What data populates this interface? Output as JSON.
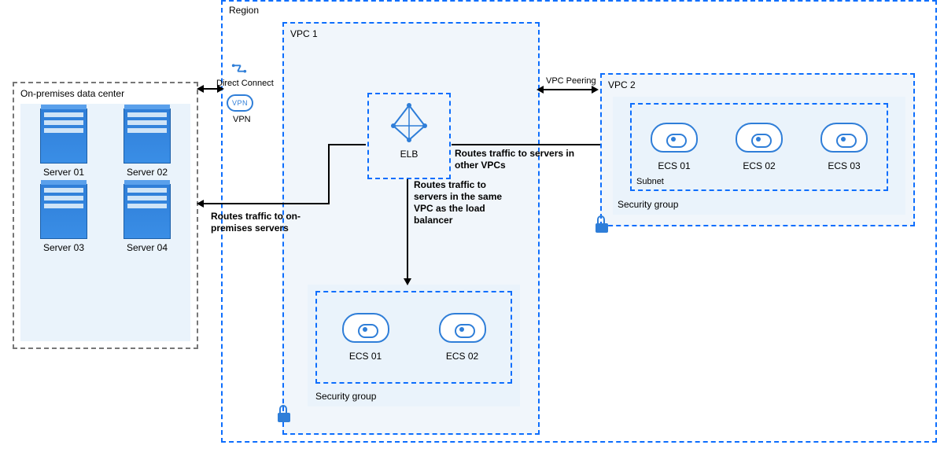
{
  "region_label": "Region",
  "onprem": {
    "title": "On-premises data center",
    "servers": [
      "Server 01",
      "Server 02",
      "Server 03",
      "Server 04"
    ]
  },
  "connections": {
    "direct_connect": "Direct Connect",
    "vpn": "VPN",
    "vpc_peering": "VPC Peering"
  },
  "routes": {
    "to_onprem": "Routes traffic to on-premises servers",
    "same_vpc": "Routes traffic to servers in the same VPC as the load balancer",
    "other_vpcs": "Routes traffic to servers in other VPCs"
  },
  "vpc1": {
    "label": "VPC 1",
    "elb_label": "ELB",
    "security_group_label": "Security group",
    "ecs": [
      "ECS 01",
      "ECS 02"
    ]
  },
  "vpc2": {
    "label": "VPC 2",
    "security_group_label": "Security group",
    "subnet_label": "Subnet",
    "ecs": [
      "ECS 01",
      "ECS 02",
      "ECS 03"
    ]
  },
  "colors": {
    "blue": "#0d6efd",
    "grey": "#777777",
    "pale": "#eaf3fb"
  }
}
